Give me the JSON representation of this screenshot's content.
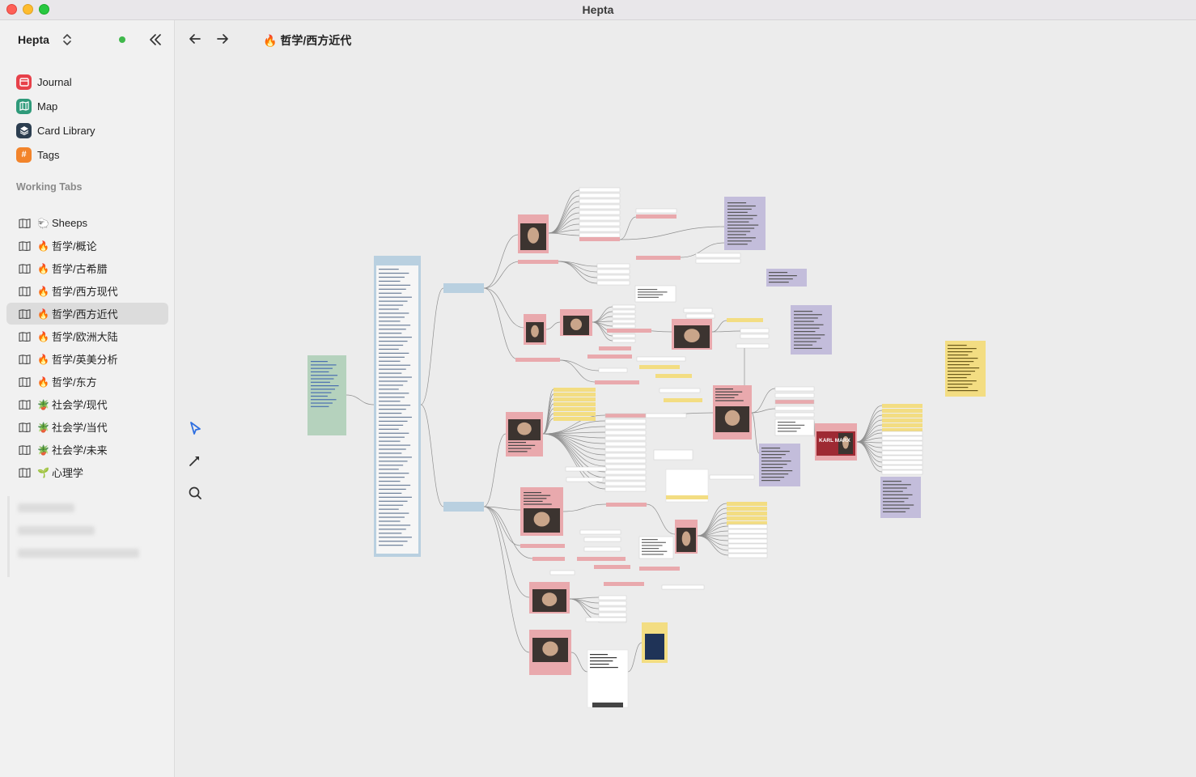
{
  "window": {
    "title": "Hepta"
  },
  "sidebar": {
    "workspace": "Hepta",
    "nav": [
      {
        "label": "Journal",
        "icon": "calendar-icon",
        "color": "#e7414a"
      },
      {
        "label": "Map",
        "icon": "map-icon",
        "color": "#2f9a7a"
      },
      {
        "label": "Card Library",
        "icon": "layers-icon",
        "color": "#2c3e50"
      },
      {
        "label": "Tags",
        "icon": "hash-icon",
        "color": "#f2842b"
      }
    ],
    "section_title": "Working Tabs",
    "tabs": [
      {
        "emoji": "🐑",
        "label": "Sheeps"
      },
      {
        "emoji": "🔥",
        "label": "哲学/概论"
      },
      {
        "emoji": "🔥",
        "label": "哲学/古希腊"
      },
      {
        "emoji": "🔥",
        "label": "哲学/西方现代"
      },
      {
        "emoji": "🔥",
        "label": "哲学/西方近代"
      },
      {
        "emoji": "🔥",
        "label": "哲学/欧洲大陆"
      },
      {
        "emoji": "🔥",
        "label": "哲学/英美分析"
      },
      {
        "emoji": "🔥",
        "label": "哲学/东方"
      },
      {
        "emoji": "🪴",
        "label": "社会学/现代"
      },
      {
        "emoji": "🪴",
        "label": "社会学/当代"
      },
      {
        "emoji": "🪴",
        "label": "社会学/未来"
      },
      {
        "emoji": "🌱",
        "label": "心理学"
      }
    ],
    "active_tab": "哲学/西方近代"
  },
  "topbar": {
    "breadcrumb": "🔥 哲学/西方近代"
  },
  "canvas": {
    "card_labels": {
      "karl_marx": "KARL MARX"
    }
  }
}
